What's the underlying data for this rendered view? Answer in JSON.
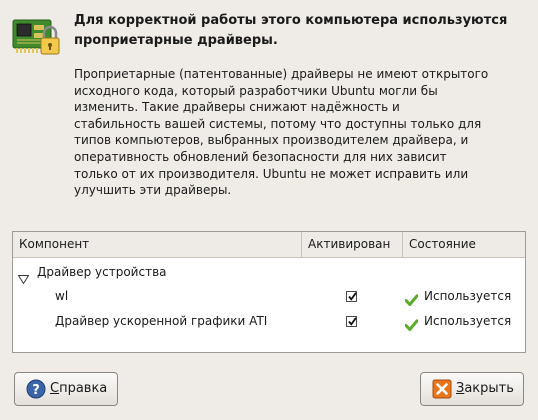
{
  "dialog": {
    "heading": "Для корректной работы этого компьютера используются проприетарные драйверы.",
    "description": "Проприетарные (патентованные) драйверы не имеют открытого исходного кода, который разработчики Ubuntu могли бы изменить. Такие драйверы снижают надёжность и стабильность вашей системы, потому что доступны только для типов компьютеров, выбранных производителем драйвера, и оперативность обновлений безопасности для них зависит только от их производителя. Ubuntu не может исправить или улучшить эти драйверы."
  },
  "table": {
    "columns": [
      "Компонент",
      "Активирован",
      "Состояние"
    ],
    "group": {
      "label": "Драйвер устройства",
      "expanded": true
    },
    "rows": [
      {
        "name": "wl",
        "activated": true,
        "status": "Используется"
      },
      {
        "name": "Драйвер ускоренной графики ATI",
        "activated": true,
        "status": "Используется"
      }
    ]
  },
  "buttons": {
    "help": {
      "mnemonic": "С",
      "rest": "правка",
      "icon": "help-icon"
    },
    "close": {
      "mnemonic": "З",
      "rest": "акрыть",
      "icon": "close-icon"
    }
  },
  "colors": {
    "status_ok": "#5aab2a",
    "close_icon": "#e8741c",
    "help_icon": "#3a65a8"
  }
}
